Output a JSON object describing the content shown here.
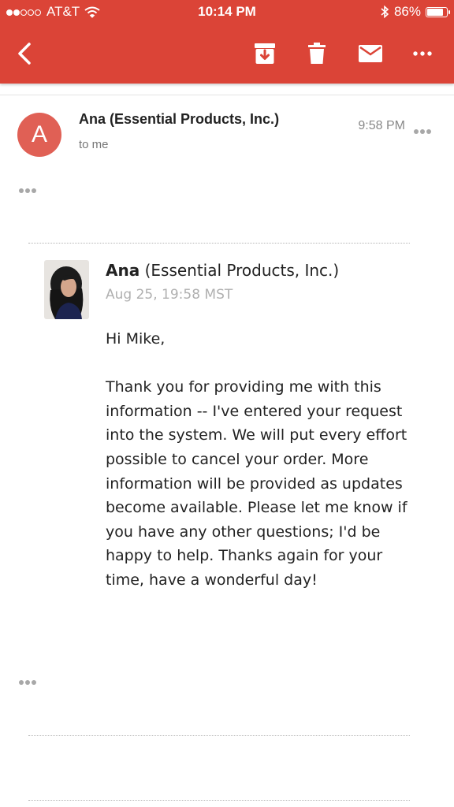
{
  "status_bar": {
    "carrier": "AT&T",
    "time": "10:14 PM",
    "battery": "86%",
    "battery_level": 0.86
  },
  "toolbar": {
    "icons": [
      "back-icon",
      "archive-icon",
      "trash-icon",
      "mail-icon",
      "more-icon"
    ]
  },
  "message": {
    "avatar_letter": "A",
    "sender": "Ana (Essential Products, Inc.)",
    "recipient": "to me",
    "time": "9:58 PM"
  },
  "quoted": {
    "name_bold": "Ana",
    "name_rest": "(Essential Products, Inc.)",
    "date": "Aug 25, 19:58 MST",
    "greeting": "Hi Mike,",
    "body": "Thank you for providing me with this information -- I've entered your request into the system. We will put every effort possible to cancel your order. More information will be provided as updates become available. Please let me know if you have any other questions; I'd be happy to help. Thanks again for your time, have a wonderful day!"
  },
  "colors": {
    "brand": "#db4437",
    "avatar": "#e06055"
  }
}
